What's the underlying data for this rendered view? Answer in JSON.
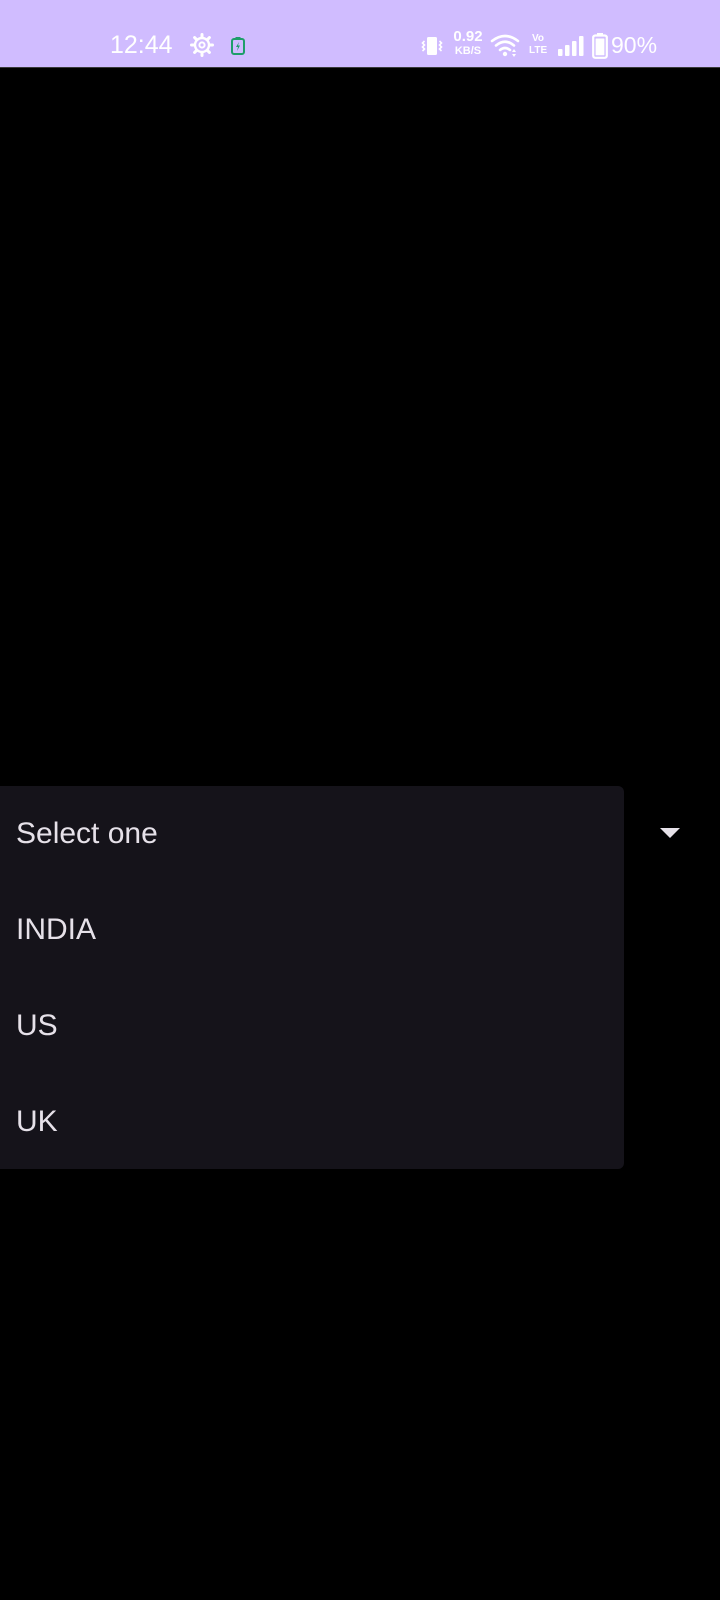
{
  "status_bar": {
    "time": "12:44",
    "net_speed_value": "0.92",
    "net_speed_unit": "KB/S",
    "volte_top": "Vo",
    "volte_bottom": "LTE",
    "battery_percent": "90%",
    "background_color": "#d0bcff",
    "icons": [
      "gear-icon",
      "battery-charging-icon",
      "vibrate-icon",
      "wifi-icon",
      "volte-icon",
      "signal-icon",
      "battery-icon"
    ]
  },
  "spinner": {
    "arrow_icon": "dropdown-arrow-icon",
    "options": [
      {
        "label": "Select one"
      },
      {
        "label": "INDIA"
      },
      {
        "label": "US"
      },
      {
        "label": "UK"
      }
    ]
  },
  "colors": {
    "background": "#000000",
    "popup_background": "#15131a",
    "text": "#e6e1e9"
  }
}
